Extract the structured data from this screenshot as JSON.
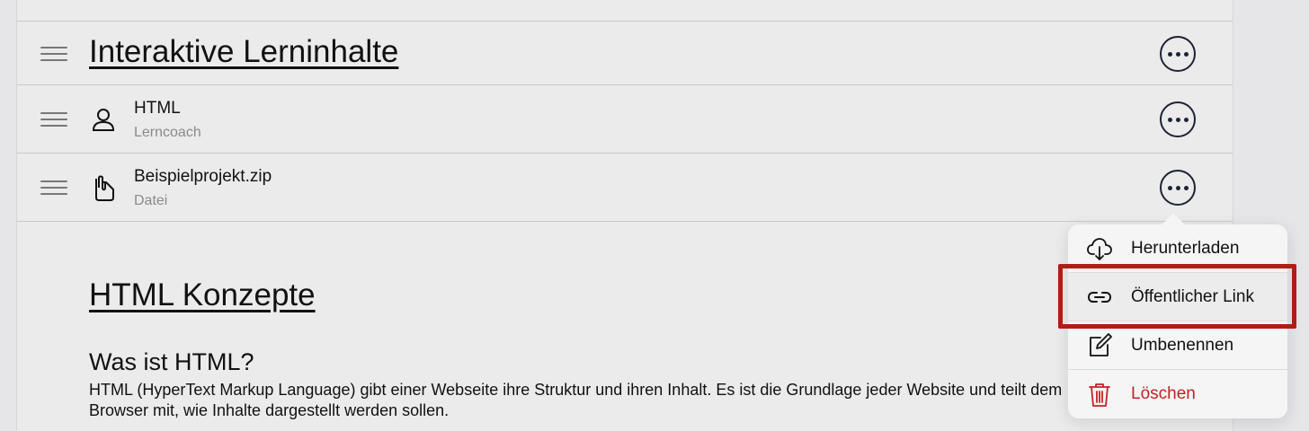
{
  "header": {
    "title": "Interaktive Lerninhalte"
  },
  "items": [
    {
      "title": "HTML",
      "subtitle": "Lerncoach",
      "icon": "user-icon"
    },
    {
      "title": "Beispielprojekt.zip",
      "subtitle": "Datei",
      "icon": "file-attachment-icon"
    }
  ],
  "content": {
    "title": "HTML Konzepte",
    "heading": "Was ist HTML?",
    "paragraph": "HTML (HyperText Markup Language) gibt einer Webseite ihre Struktur und ihren Inhalt. Es ist die Grundlage jeder Website und teilt dem Browser mit, wie Inhalte dargestellt werden sollen."
  },
  "context_menu": {
    "items": [
      {
        "label": "Herunterladen",
        "icon": "cloud-download-icon"
      },
      {
        "label": "Öffentlicher Link",
        "icon": "link-icon"
      },
      {
        "label": "Umbenennen",
        "icon": "edit-icon"
      },
      {
        "label": "Löschen",
        "icon": "trash-icon"
      }
    ],
    "danger_color": "#c22229"
  },
  "colors": {
    "icon_dark": "#1e2333",
    "highlight": "#b01d14"
  }
}
